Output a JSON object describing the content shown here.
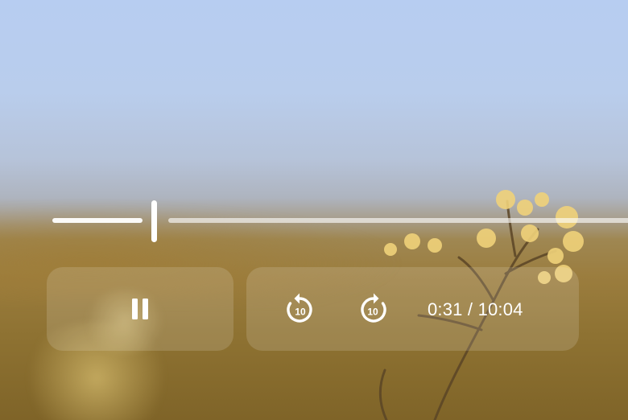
{
  "player": {
    "state": "playing",
    "current_time": "0:31",
    "time_separator": " / ",
    "duration": "10:04",
    "progress_fraction": 0.051
  },
  "controls": {
    "pause_icon": "pause-icon",
    "rewind_icon": "replay-10-icon",
    "rewind_label": "10",
    "forward_icon": "forward-10-icon",
    "forward_label": "10"
  },
  "colors": {
    "sky": "#b7cdf1",
    "field": "#9b7d3e",
    "control_fg": "#ffffff"
  }
}
